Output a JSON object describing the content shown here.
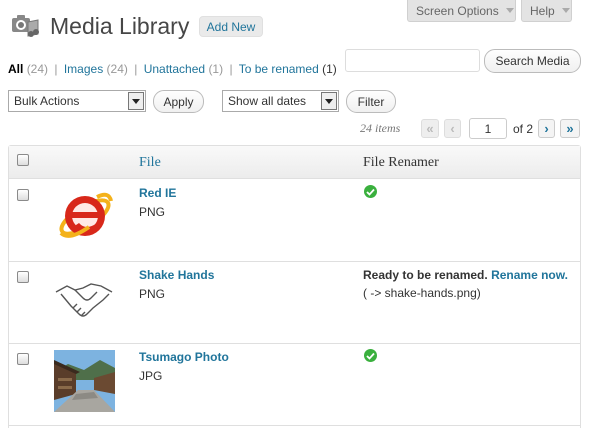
{
  "header": {
    "title": "Media Library",
    "add_new": "Add New",
    "screen_options": "Screen Options",
    "help": "Help"
  },
  "filters": {
    "all": {
      "label": "All",
      "count": "(24)"
    },
    "images": {
      "label": "Images",
      "count": "(24)"
    },
    "unattached": {
      "label": "Unattached",
      "count": "(1)"
    },
    "to_be_renamed": {
      "label": "To be renamed",
      "count": "(1)"
    },
    "separator": "|"
  },
  "search": {
    "value": "",
    "button": "Search Media"
  },
  "bulk": {
    "selected": "Bulk Actions",
    "apply": "Apply"
  },
  "dates": {
    "selected": "Show all dates",
    "filter": "Filter"
  },
  "pagination": {
    "items": "24 items",
    "first": "«",
    "prev": "‹",
    "current_page": "1",
    "of_total": "of 2",
    "next": "›",
    "last": "»"
  },
  "table": {
    "col_file": "File",
    "col_renamer": "File Renamer",
    "rows": [
      {
        "title": "Red IE",
        "mime": "PNG",
        "status": "ok"
      },
      {
        "title": "Shake Hands",
        "mime": "PNG",
        "status_text": "Ready to be renamed.",
        "action": "Rename now.",
        "new_name": "( -> shake-hands.png)"
      },
      {
        "title": "Tsumago Photo",
        "mime": "JPG",
        "status": "ok"
      }
    ]
  },
  "colors": {
    "link": "#21759b",
    "ok": "#3ab03e",
    "ie_red": "#d8281a",
    "ie_orbit": "#f4b21b"
  }
}
